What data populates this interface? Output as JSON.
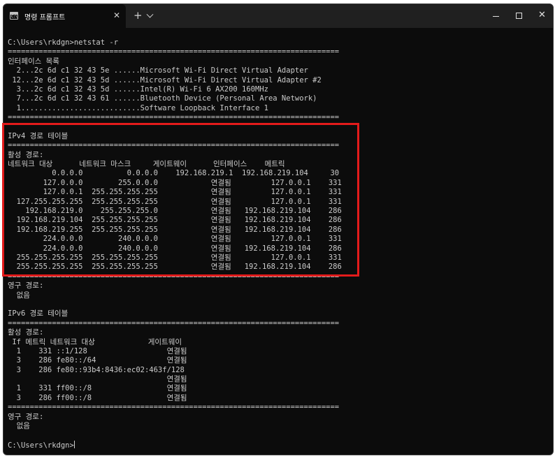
{
  "tab": {
    "title": "명령 프롬프트",
    "icon_text": "C:\\"
  },
  "window_controls": {
    "minimize": "—",
    "maximize": "☐",
    "close": "✕"
  },
  "terminal_lines": [
    "C:\\Users\\rkdgn>netstat -r",
    "===========================================================================",
    "인터페이스 목록",
    "  2...2c 6d c1 32 43 5e ......Microsoft Wi-Fi Direct Virtual Adapter",
    " 12...2e 6d c1 32 43 5d ......Microsoft Wi-Fi Direct Virtual Adapter #2",
    "  3...2c 6d c1 32 43 5d ......Intel(R) Wi-Fi 6 AX200 160MHz",
    "  7...2c 6d c1 32 43 61 ......Bluetooth Device (Personal Area Network)",
    "  1...........................Software Loopback Interface 1",
    "===========================================================================",
    "",
    "IPv4 경로 테이블",
    "===========================================================================",
    "활성 경로:",
    "네트워크 대상      네트워크 마스크     게이트웨이      인터페이스    메트릭",
    "          0.0.0.0          0.0.0.0    192.168.219.1  192.168.219.104     30",
    "        127.0.0.0        255.0.0.0            연결됨         127.0.0.1    331",
    "        127.0.0.1  255.255.255.255            연결됨         127.0.0.1    331",
    "  127.255.255.255  255.255.255.255            연결됨         127.0.0.1    331",
    "    192.168.219.0    255.255.255.0            연결됨   192.168.219.104    286",
    "  192.168.219.104  255.255.255.255            연결됨   192.168.219.104    286",
    "  192.168.219.255  255.255.255.255            연결됨   192.168.219.104    286",
    "        224.0.0.0        240.0.0.0            연결됨         127.0.0.1    331",
    "        224.0.0.0        240.0.0.0            연결됨   192.168.219.104    286",
    "  255.255.255.255  255.255.255.255            연결됨         127.0.0.1    331",
    "  255.255.255.255  255.255.255.255            연결됨   192.168.219.104    286",
    "===========================================================================",
    "영구 경로:",
    "  없음",
    "",
    "IPv6 경로 테이블",
    "===========================================================================",
    "활성 경로:",
    " If 메트릭 네트워크 대상            게이트웨이",
    "  1    331 ::1/128                  연결됨",
    "  3    286 fe80::/64                연결됨",
    "  3    286 fe80::93b4:8436:ec02:463f/128",
    "                                    연결됨",
    "  1    331 ff00::/8                 연결됨",
    "  3    286 ff00::/8                 연결됨",
    "===========================================================================",
    "영구 경로:",
    "  없음",
    "",
    "C:\\Users\\rkdgn>"
  ]
}
